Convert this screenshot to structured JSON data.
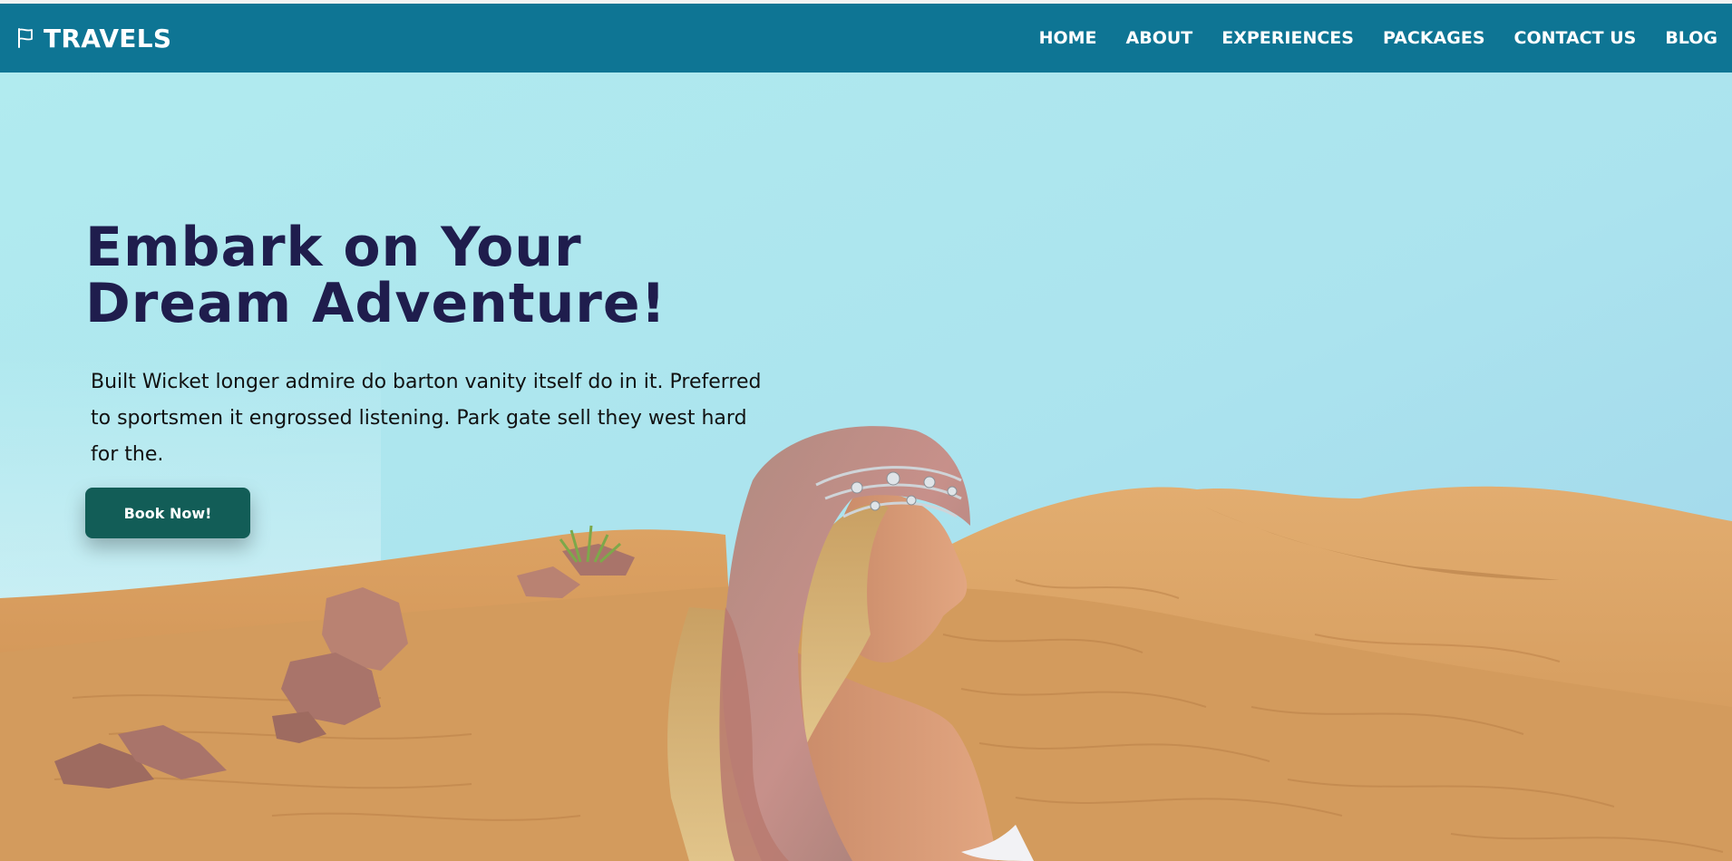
{
  "brand": {
    "name": "TRAVELS",
    "icon": "flag-icon"
  },
  "nav": {
    "items": [
      {
        "label": "HOME"
      },
      {
        "label": "ABOUT"
      },
      {
        "label": "EXPERIENCES"
      },
      {
        "label": "PACKAGES"
      },
      {
        "label": "CONTACT US"
      },
      {
        "label": "BLOG"
      }
    ]
  },
  "hero": {
    "title": "Embark on Your Dream Adventure!",
    "description": "Built Wicket longer admire do barton vanity itself do in it. Preferred to sportsmen it engrossed listening. Park gate sell they west hard for the.",
    "cta_label": "Book Now!"
  },
  "colors": {
    "nav_bg": "#0e7594",
    "title": "#1f1d4d",
    "button_bg": "#125d57",
    "sky": "#aee8ee",
    "sand": "#d9a162"
  }
}
